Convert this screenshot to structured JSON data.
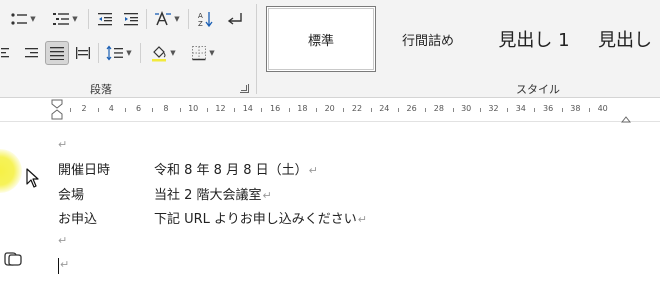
{
  "ribbon": {
    "paragraph_group_label": "段落",
    "styles_group_label": "スタイル",
    "styles": [
      {
        "label": "標準",
        "selected": true
      },
      {
        "label": "行間詰め",
        "selected": false
      },
      {
        "label": "見出し 1",
        "selected": false
      },
      {
        "label": "見出し",
        "selected": false
      }
    ]
  },
  "ruler": {
    "numbers": [
      "2",
      "4",
      "6",
      "8",
      "10",
      "12",
      "14",
      "16",
      "18",
      "20",
      "22",
      "24",
      "26",
      "28",
      "30",
      "32",
      "34",
      "36",
      "38",
      "40"
    ]
  },
  "document": {
    "paragraph_mark": "↵",
    "lines": [
      {
        "label": "開催日時",
        "value": "令和 8 年 8 月 8 日（土）"
      },
      {
        "label": "会場",
        "value": "当社 2 階大会議室"
      },
      {
        "label": "お申込",
        "value": "下記 URL よりお申し込みください"
      }
    ]
  }
}
